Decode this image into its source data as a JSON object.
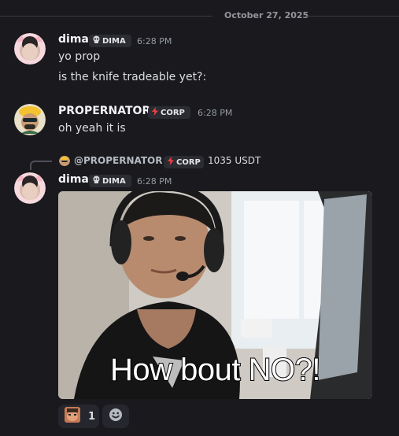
{
  "divider": {
    "date": "October 27, 2025"
  },
  "messages": [
    {
      "author": "dima",
      "tag": "DIMA",
      "time": "6:28 PM",
      "lines": [
        "yo prop",
        "is the knife tradeable yet?:"
      ]
    },
    {
      "author": "PROPERNATOR",
      "tag": "CORP",
      "time": "6:28 PM",
      "lines": [
        "oh yeah it is"
      ]
    },
    {
      "reply": {
        "mention": "@PROPERNATOR",
        "tag": "CORP",
        "text": "1035 USDT"
      },
      "author": "dima",
      "tag": "DIMA",
      "time": "6:28 PM",
      "media_caption": "How bout NO?!",
      "reaction": {
        "emoji": "face-emoji",
        "count": "1"
      }
    }
  ],
  "colors": {
    "background": "#1a1a1e",
    "tag_bg": "#2b2c32",
    "corp_red": "#f23f43",
    "timestamp": "#949ba4"
  },
  "icons": {
    "dima_tag": "skull-icon",
    "corp_tag": "lightning-icon",
    "add_reaction": "smile-icon"
  }
}
